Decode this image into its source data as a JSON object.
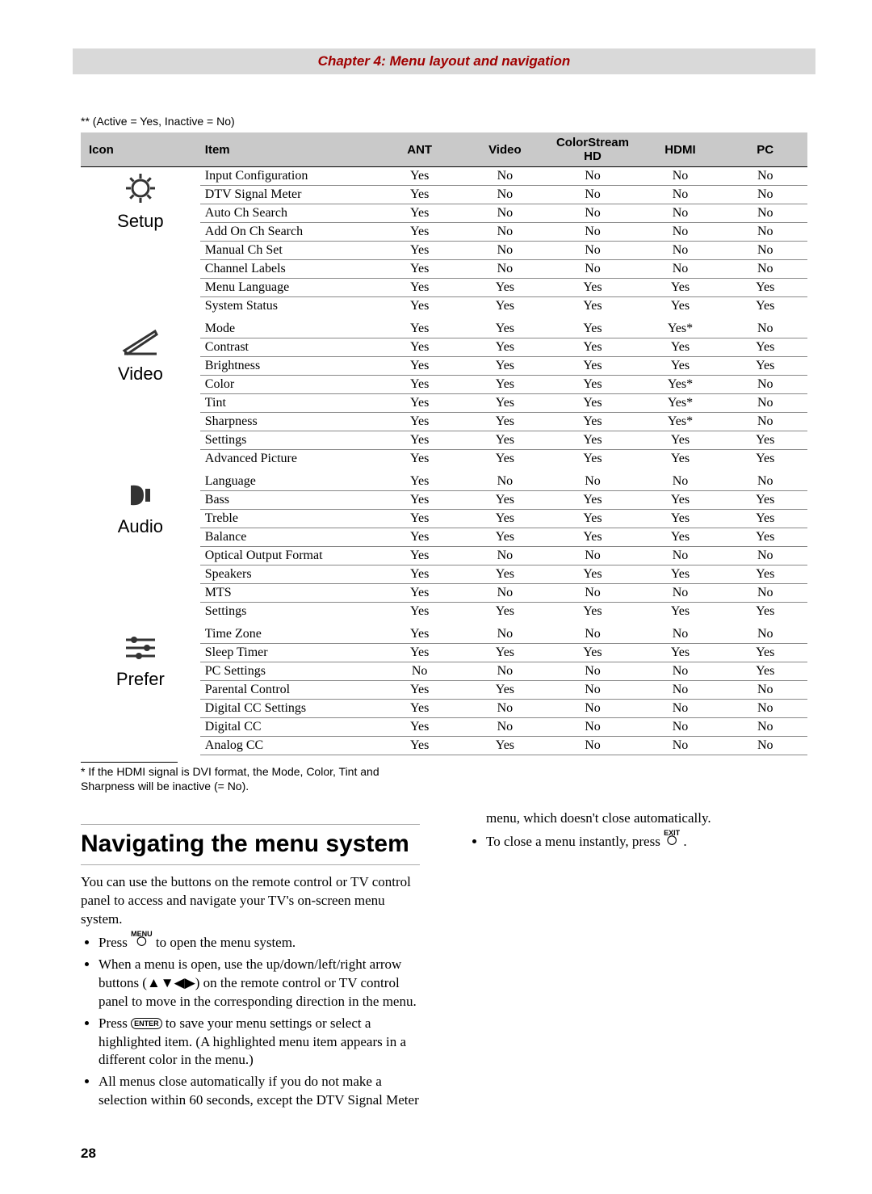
{
  "header": "Chapter 4: Menu layout and navigation",
  "legend": "** (Active = Yes, Inactive = No)",
  "columns": [
    "Icon",
    "Item",
    "ANT",
    "Video",
    "ColorStream HD",
    "HDMI",
    "PC"
  ],
  "groups": [
    {
      "icon": "setup",
      "label": "Setup",
      "rows": [
        {
          "item": "Input Configuration",
          "v": [
            "Yes",
            "No",
            "No",
            "No",
            "No"
          ]
        },
        {
          "item": "DTV Signal Meter",
          "v": [
            "Yes",
            "No",
            "No",
            "No",
            "No"
          ]
        },
        {
          "item": "Auto Ch Search",
          "v": [
            "Yes",
            "No",
            "No",
            "No",
            "No"
          ]
        },
        {
          "item": "Add On Ch Search",
          "v": [
            "Yes",
            "No",
            "No",
            "No",
            "No"
          ]
        },
        {
          "item": "Manual Ch Set",
          "v": [
            "Yes",
            "No",
            "No",
            "No",
            "No"
          ]
        },
        {
          "item": "Channel Labels",
          "v": [
            "Yes",
            "No",
            "No",
            "No",
            "No"
          ]
        },
        {
          "item": "Menu Language",
          "v": [
            "Yes",
            "Yes",
            "Yes",
            "Yes",
            "Yes"
          ]
        },
        {
          "item": "System Status",
          "v": [
            "Yes",
            "Yes",
            "Yes",
            "Yes",
            "Yes"
          ]
        }
      ]
    },
    {
      "icon": "video",
      "label": "Video",
      "rows": [
        {
          "item": "Mode",
          "v": [
            "Yes",
            "Yes",
            "Yes",
            "Yes*",
            "No"
          ]
        },
        {
          "item": "Contrast",
          "v": [
            "Yes",
            "Yes",
            "Yes",
            "Yes",
            "Yes"
          ]
        },
        {
          "item": "Brightness",
          "v": [
            "Yes",
            "Yes",
            "Yes",
            "Yes",
            "Yes"
          ]
        },
        {
          "item": "Color",
          "v": [
            "Yes",
            "Yes",
            "Yes",
            "Yes*",
            "No"
          ]
        },
        {
          "item": "Tint",
          "v": [
            "Yes",
            "Yes",
            "Yes",
            "Yes*",
            "No"
          ]
        },
        {
          "item": "Sharpness",
          "v": [
            "Yes",
            "Yes",
            "Yes",
            "Yes*",
            "No"
          ]
        },
        {
          "item": "Settings",
          "v": [
            "Yes",
            "Yes",
            "Yes",
            "Yes",
            "Yes"
          ]
        },
        {
          "item": "Advanced Picture",
          "v": [
            "Yes",
            "Yes",
            "Yes",
            "Yes",
            "Yes"
          ]
        }
      ]
    },
    {
      "icon": "audio",
      "label": "Audio",
      "rows": [
        {
          "item": "Language",
          "v": [
            "Yes",
            "No",
            "No",
            "No",
            "No"
          ]
        },
        {
          "item": "Bass",
          "v": [
            "Yes",
            "Yes",
            "Yes",
            "Yes",
            "Yes"
          ]
        },
        {
          "item": "Treble",
          "v": [
            "Yes",
            "Yes",
            "Yes",
            "Yes",
            "Yes"
          ]
        },
        {
          "item": "Balance",
          "v": [
            "Yes",
            "Yes",
            "Yes",
            "Yes",
            "Yes"
          ]
        },
        {
          "item": "Optical Output Format",
          "v": [
            "Yes",
            "No",
            "No",
            "No",
            "No"
          ]
        },
        {
          "item": "Speakers",
          "v": [
            "Yes",
            "Yes",
            "Yes",
            "Yes",
            "Yes"
          ]
        },
        {
          "item": "MTS",
          "v": [
            "Yes",
            "No",
            "No",
            "No",
            "No"
          ]
        },
        {
          "item": "Settings",
          "v": [
            "Yes",
            "Yes",
            "Yes",
            "Yes",
            "Yes"
          ]
        }
      ]
    },
    {
      "icon": "prefer",
      "label": "Prefer",
      "rows": [
        {
          "item": "Time Zone",
          "v": [
            "Yes",
            "No",
            "No",
            "No",
            "No"
          ]
        },
        {
          "item": "Sleep Timer",
          "v": [
            "Yes",
            "Yes",
            "Yes",
            "Yes",
            "Yes"
          ]
        },
        {
          "item": "PC Settings",
          "v": [
            "No",
            "No",
            "No",
            "No",
            "Yes"
          ]
        },
        {
          "item": "Parental Control",
          "v": [
            "Yes",
            "Yes",
            "No",
            "No",
            "No"
          ]
        },
        {
          "item": "Digital CC Settings",
          "v": [
            "Yes",
            "No",
            "No",
            "No",
            "No"
          ]
        },
        {
          "item": "Digital CC",
          "v": [
            "Yes",
            "No",
            "No",
            "No",
            "No"
          ]
        },
        {
          "item": "Analog CC",
          "v": [
            "Yes",
            "Yes",
            "No",
            "No",
            "No"
          ]
        }
      ]
    }
  ],
  "footnote": "*  If the HDMI signal is DVI format, the Mode, Color, Tint and Sharpness will be inactive (= No).",
  "section_title": "Navigating the menu system",
  "body": {
    "intro": "You can use the buttons on the remote control or TV control panel to access and navigate your TV's on-screen menu system.",
    "b1a": "Press ",
    "b1b": " to open the menu system.",
    "b2": "When a menu is open, use the up/down/left/right arrow buttons (▲▼◀▶) on the remote control or TV control panel to move in the corresponding direction in the menu.",
    "b3a": "Press ",
    "b3b": " to save your menu settings or select a highlighted item. (A highlighted menu item appears in a different color in the menu.)",
    "b4": "All menus close automatically if you do not make a selection within 60 seconds, except the DTV Signal Meter",
    "r1": "menu, which doesn't close automatically.",
    "r2a": "To close a menu instantly, press ",
    "r2b": "."
  },
  "labels": {
    "menu": "MENU",
    "enter": "ENTER",
    "exit": "EXIT"
  },
  "page_number": "28"
}
